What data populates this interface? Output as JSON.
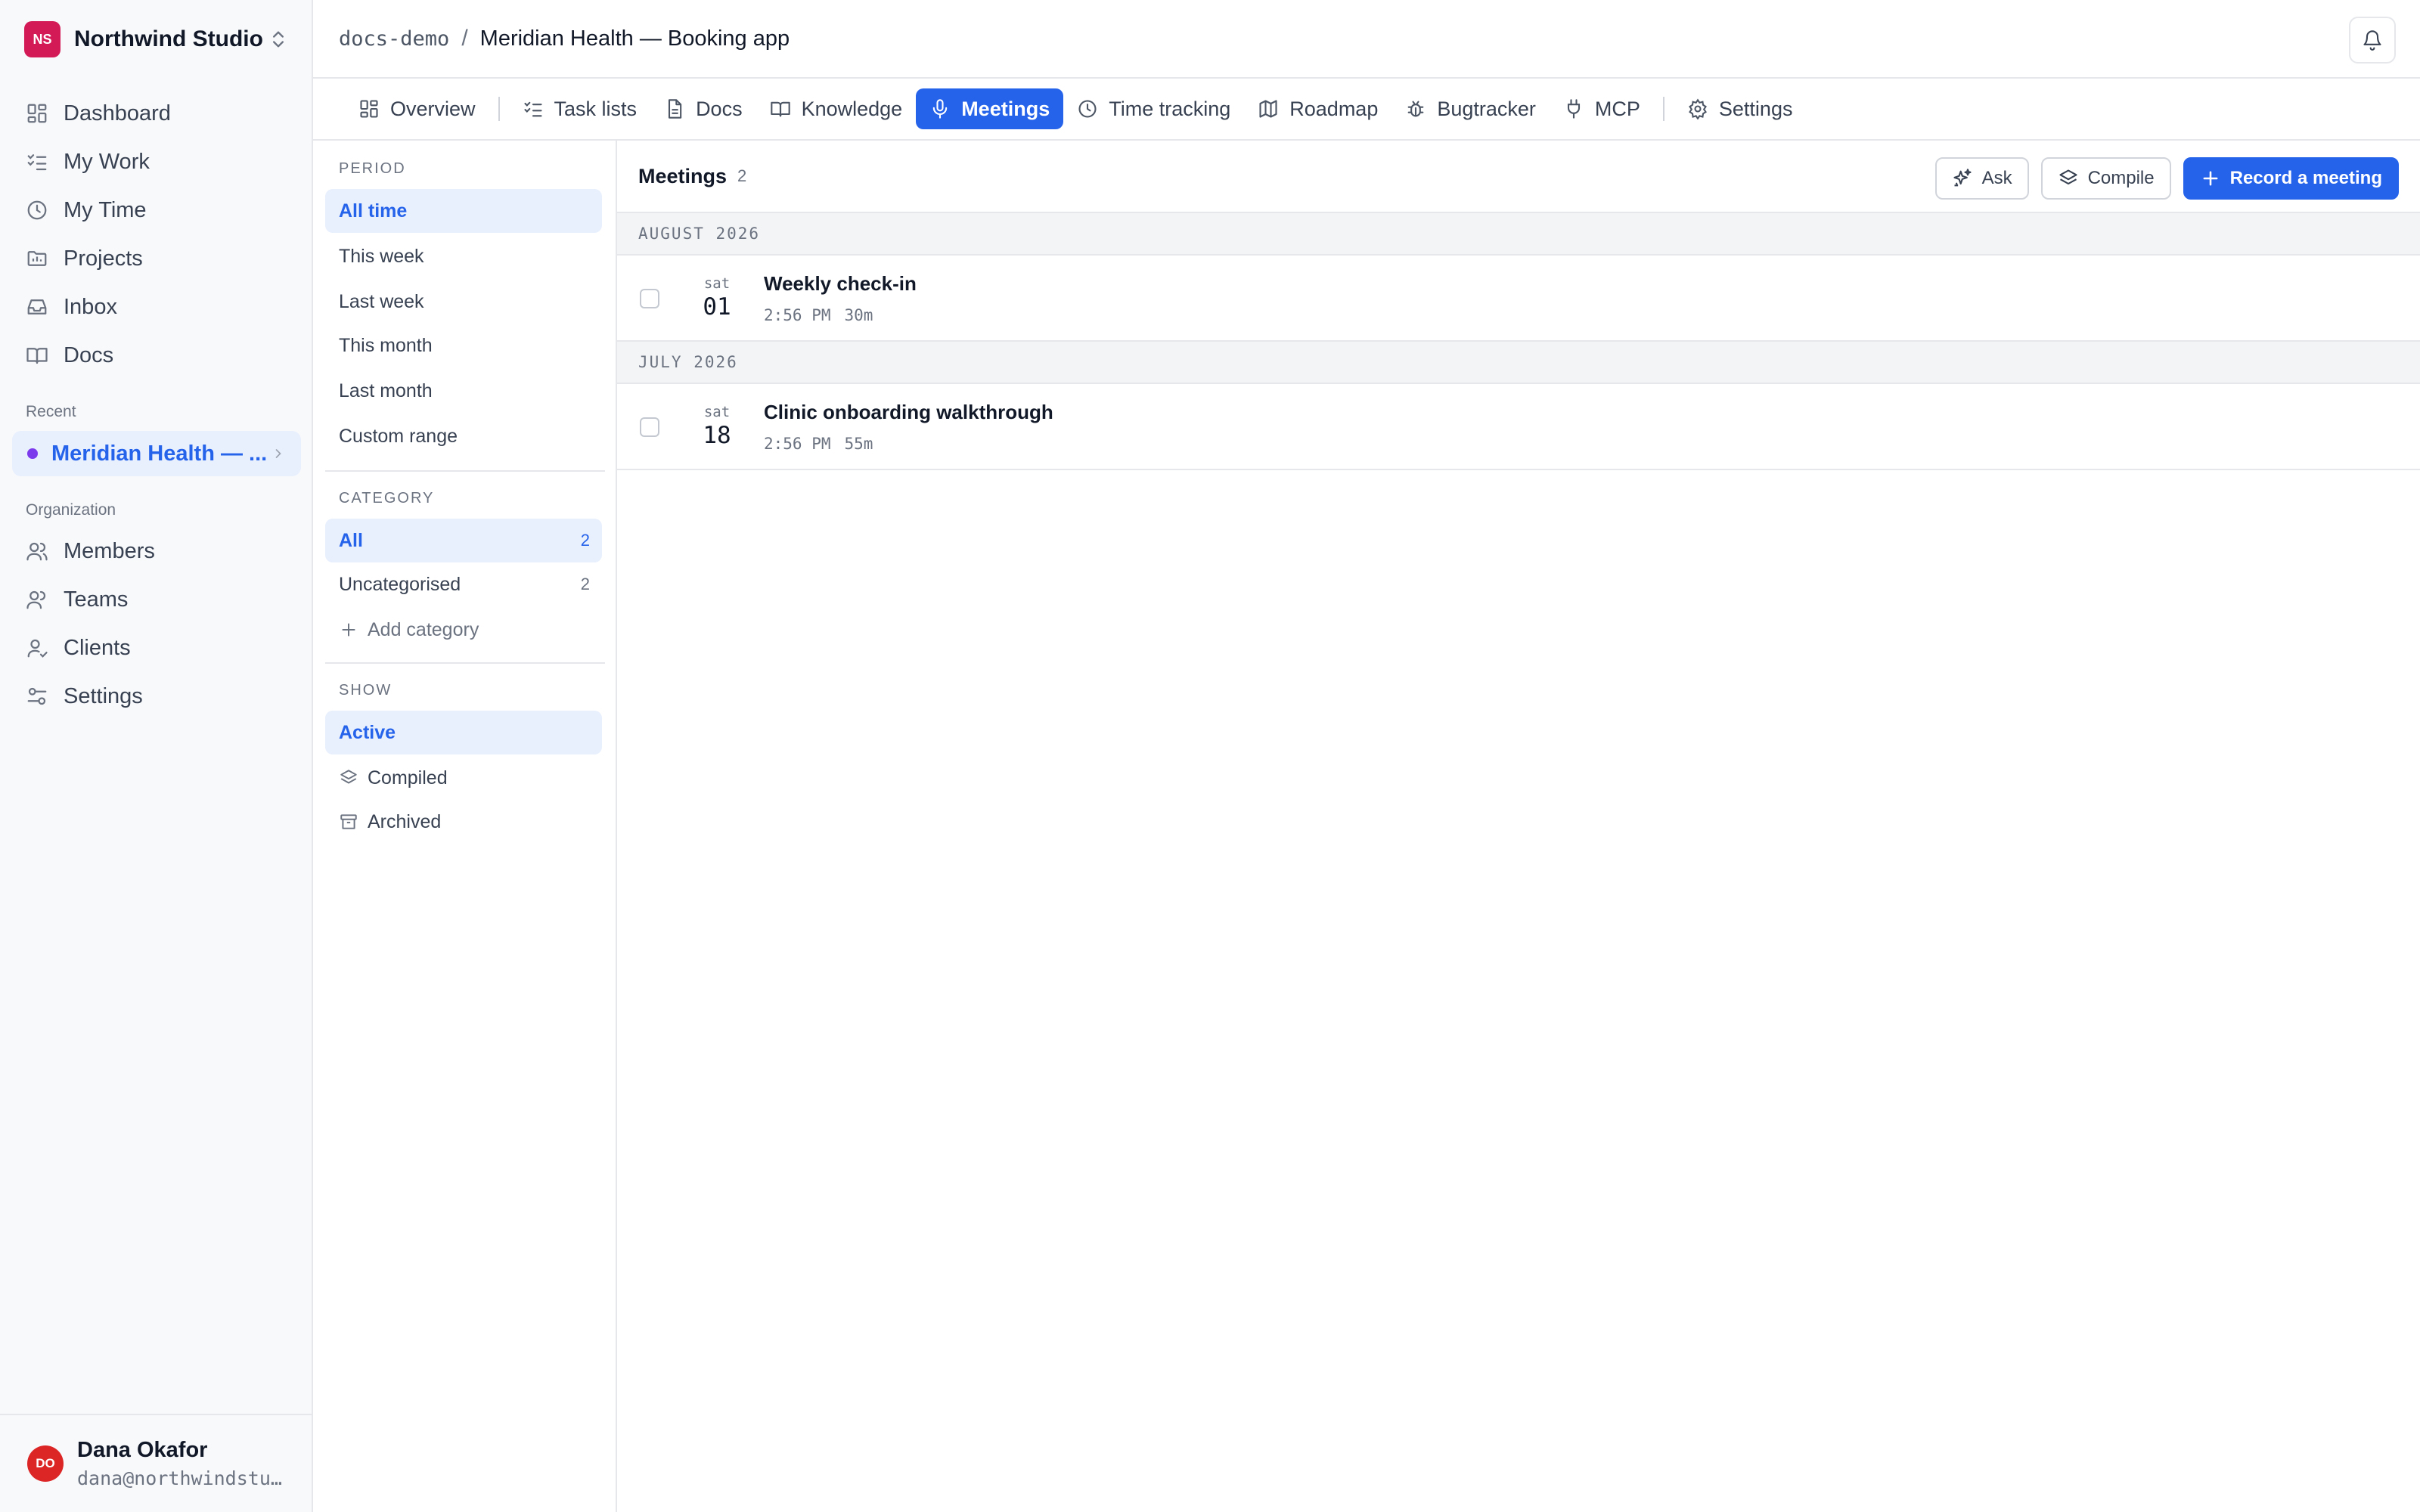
{
  "workspace": {
    "initials": "NS",
    "name": "Northwind Studio"
  },
  "sidebar": {
    "nav": [
      {
        "label": "Dashboard",
        "icon": "dashboard-icon"
      },
      {
        "label": "My Work",
        "icon": "checklist-icon"
      },
      {
        "label": "My Time",
        "icon": "clock-icon"
      },
      {
        "label": "Projects",
        "icon": "folder-icon"
      },
      {
        "label": "Inbox",
        "icon": "inbox-icon"
      },
      {
        "label": "Docs",
        "icon": "book-icon"
      }
    ],
    "recent_label": "Recent",
    "recent_item": "Meridian Health — ...",
    "org_label": "Organization",
    "org": [
      {
        "label": "Members",
        "icon": "members-icon"
      },
      {
        "label": "Teams",
        "icon": "teams-icon"
      },
      {
        "label": "Clients",
        "icon": "client-icon"
      },
      {
        "label": "Settings",
        "icon": "settings-sliders-icon"
      }
    ]
  },
  "user": {
    "initials": "DO",
    "name": "Dana Okafor",
    "email": "dana@northwindstud…"
  },
  "breadcrumb": {
    "project_slug": "docs-demo",
    "separator": "/",
    "project_name": "Meridian Health — Booking app"
  },
  "tabs": [
    {
      "label": "Overview",
      "icon": "grid-icon"
    },
    {
      "label": "Task lists",
      "icon": "checklist-icon"
    },
    {
      "label": "Docs",
      "icon": "document-icon"
    },
    {
      "label": "Knowledge",
      "icon": "book-icon"
    },
    {
      "label": "Meetings",
      "icon": "microphone-icon",
      "active": true
    },
    {
      "label": "Time tracking",
      "icon": "clock-icon"
    },
    {
      "label": "Roadmap",
      "icon": "map-icon"
    },
    {
      "label": "Bugtracker",
      "icon": "bug-icon"
    },
    {
      "label": "MCP",
      "icon": "plug-icon"
    },
    {
      "label": "Settings",
      "icon": "gear-icon"
    }
  ],
  "filters": {
    "period_label": "PERIOD",
    "period": [
      "All time",
      "This week",
      "Last week",
      "This month",
      "Last month",
      "Custom range"
    ],
    "period_selected": "All time",
    "category_label": "CATEGORY",
    "categories": [
      {
        "label": "All",
        "count": "2"
      },
      {
        "label": "Uncategorised",
        "count": "2"
      }
    ],
    "add_category": "Add category",
    "show_label": "SHOW",
    "show": [
      "Active",
      "Compiled",
      "Archived"
    ],
    "show_selected": "Active"
  },
  "meetings": {
    "title": "Meetings",
    "count": "2",
    "actions": {
      "ask": "Ask",
      "compile": "Compile",
      "record": "Record a meeting"
    },
    "groups": [
      {
        "month": "AUGUST 2026",
        "items": [
          {
            "dow": "sat",
            "day": "01",
            "title": "Weekly check-in",
            "time": "2:56 PM",
            "duration": "30m"
          }
        ]
      },
      {
        "month": "JULY 2026",
        "items": [
          {
            "dow": "sat",
            "day": "18",
            "title": "Clinic onboarding walkthrough",
            "time": "2:56 PM",
            "duration": "55m"
          }
        ]
      }
    ]
  },
  "colors": {
    "accent": "#2563eb",
    "workspace_logo": "#d31a56",
    "user_avatar": "#dc2626",
    "recent_dot": "#7c3aed"
  }
}
